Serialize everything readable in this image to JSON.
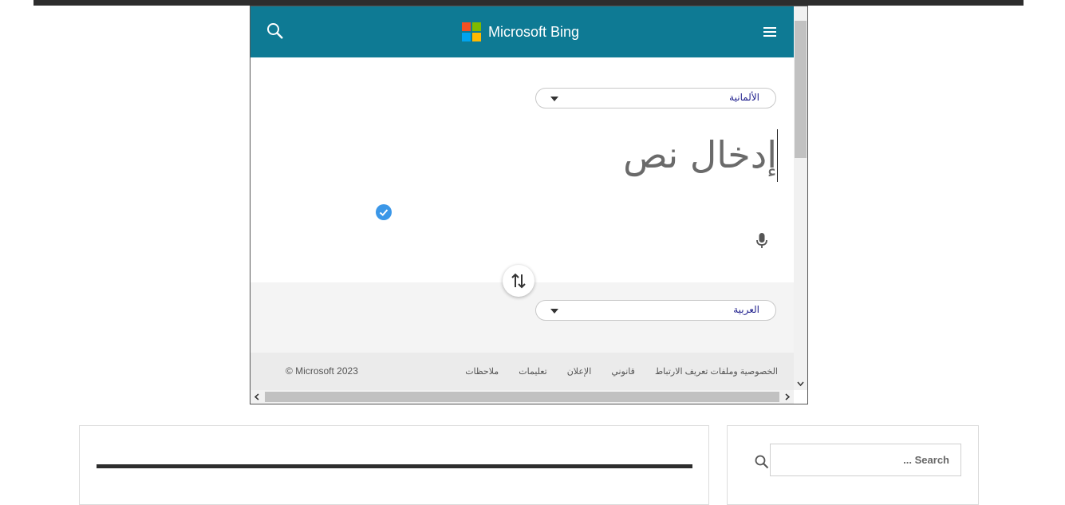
{
  "header": {
    "brand": "Microsoft Bing"
  },
  "translator": {
    "source_language": "الألمانية",
    "source_placeholder": "إدخال نص",
    "target_language": "العربية"
  },
  "footer": {
    "copyright": "© Microsoft 2023",
    "links": [
      "الخصوصية وملفات تعريف الارتباط",
      "قانوني",
      "الإعلان",
      "تعليمات",
      "ملاحظات"
    ]
  },
  "sidebar": {
    "search_placeholder": "Search ..."
  },
  "colors": {
    "header": "#0e7a94",
    "check": "#3b97e8",
    "logo": [
      "#f25022",
      "#7fba00",
      "#00a4ef",
      "#ffb900"
    ]
  }
}
